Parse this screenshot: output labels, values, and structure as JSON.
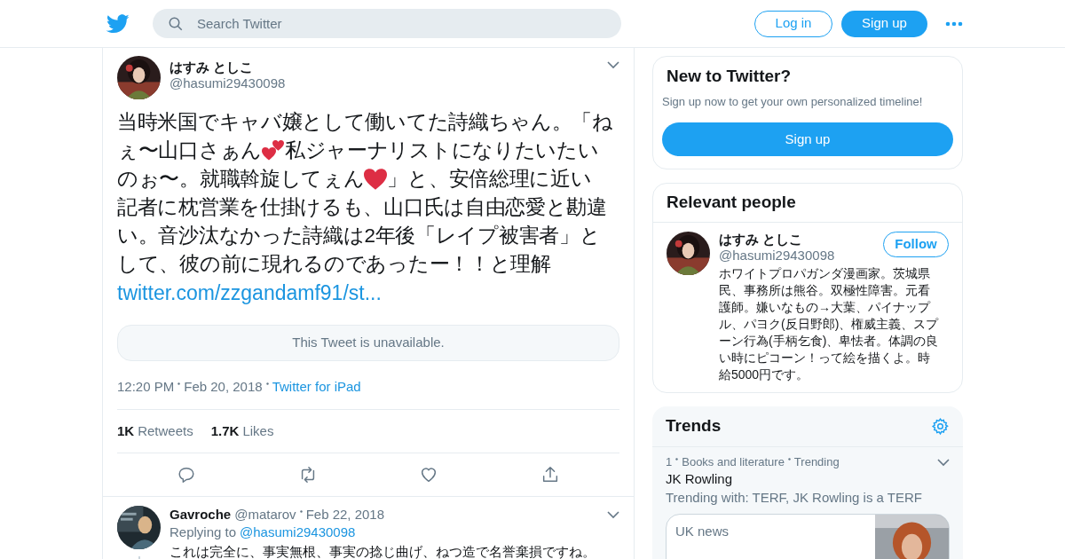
{
  "header": {
    "search": {
      "placeholder": "Search Twitter"
    },
    "login": "Log in",
    "signup": "Sign up"
  },
  "tweet": {
    "name": "はすみ としこ",
    "handle": "@hasumi29430098",
    "lines": [
      [
        {
          "kind": "text",
          "text": "当時米国でキャバ嬢として働いてた詩織ちゃん。「ね"
        }
      ],
      [
        {
          "kind": "text",
          "text": "ぇ〜山口さぁん"
        },
        {
          "kind": "hearts"
        },
        {
          "kind": "text",
          "text": "私ジャーナリストになりたいたい"
        }
      ],
      [
        {
          "kind": "text",
          "text": "のぉ〜。就職斡旋してぇん"
        },
        {
          "kind": "heart"
        },
        {
          "kind": "text",
          "text": "」と、安倍総理に近い"
        }
      ],
      [
        {
          "kind": "text",
          "text": "記者に枕営業を仕掛けるも、山口氏は自由恋愛と勘違"
        }
      ],
      [
        {
          "kind": "text",
          "text": "い。音沙汰なかった詩織は2年後「レイプ被害者」と"
        }
      ],
      [
        {
          "kind": "text",
          "text": "して、彼の前に現れるのであったー！！と理解"
        }
      ]
    ],
    "link": "twitter.com/zzgandamf91/st...",
    "quote": "This Tweet is unavailable.",
    "time": "12:20 PM",
    "date": "Feb 20, 2018",
    "source": "Twitter for iPad",
    "stats": [
      {
        "count": "1K",
        "label": "Retweets"
      },
      {
        "count": "1.7K",
        "label": "Likes"
      }
    ]
  },
  "reply": {
    "name": "Gavroche",
    "handle": "@matarov",
    "date": "Feb 22, 2018",
    "replying_label": "Replying to",
    "replying_to": "@hasumi29430098",
    "text": "これは完全に、事実無根、事実の捻じ曲げ、ねつ造で名誉棄損ですね。"
  },
  "new_to_twitter": {
    "title": "New to Twitter?",
    "subtitle": "Sign up now to get your own personalized timeline!",
    "button": "Sign up"
  },
  "relevant_people": {
    "title": "Relevant people",
    "people": [
      {
        "name": "はすみ としこ",
        "handle": "@hasumi29430098",
        "button": "Follow",
        "bio": "ホワイトプロパガンダ漫画家。茨城県民、事務所は熊谷。双極性障害。元看護師。嫌いなもの→大葉、パイナップル、パヨク(反日野郎)、権威主義、スプーン行為(手柄乞食)、卑怯者。体調の良い時にピコーン！って絵を描くよ。時給5000円です。"
      }
    ]
  },
  "trends": {
    "title": "Trends",
    "items": [
      {
        "rank": "1",
        "category": "Books and literature",
        "status": "Trending",
        "name": "JK Rowling",
        "trending_with": "Trending with: TERF, JK Rowling is a TERF",
        "news": {
          "label": "UK news",
          "kind": "picture"
        }
      }
    ]
  }
}
